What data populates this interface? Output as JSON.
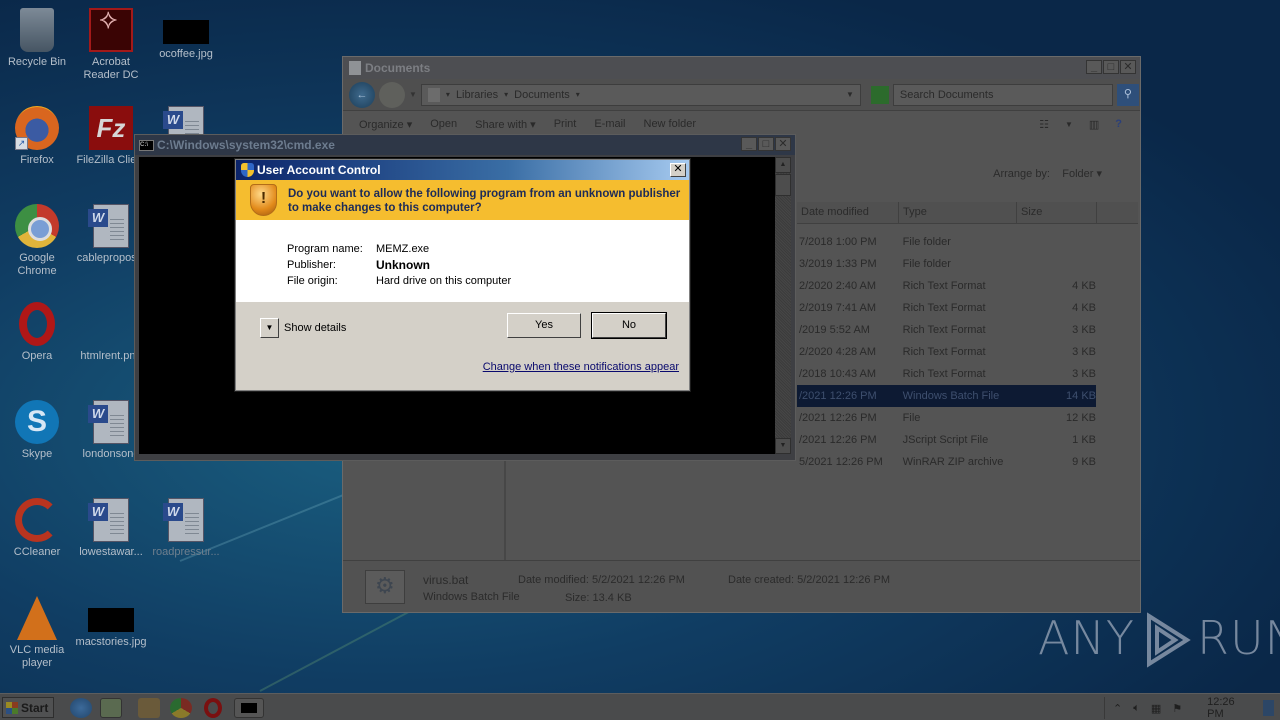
{
  "desktop": {
    "icons": [
      {
        "label": "Recycle Bin",
        "icon": "recycle-bin-icon"
      },
      {
        "label": "Acrobat Reader DC",
        "icon": "acrobat-icon"
      },
      {
        "label": "ocoffee.jpg",
        "icon": "image-file-icon"
      },
      {
        "label": "Firefox",
        "icon": "firefox-icon"
      },
      {
        "label": "FileZilla Client",
        "icon": "filezilla-icon"
      },
      {
        "label": "",
        "icon": "word-document-icon"
      },
      {
        "label": "Google Chrome",
        "icon": "chrome-icon"
      },
      {
        "label": "cableproposal",
        "icon": "word-document-icon"
      },
      {
        "label": "Opera",
        "icon": "opera-icon"
      },
      {
        "label": "htmlrent.png",
        "icon": "image-file-icon"
      },
      {
        "label": "Skype",
        "icon": "skype-icon"
      },
      {
        "label": "londonsong",
        "icon": "word-document-icon"
      },
      {
        "label": "CCleaner",
        "icon": "ccleaner-icon"
      },
      {
        "label": "lowestawar...",
        "icon": "word-document-icon"
      },
      {
        "label": "roadpressur...",
        "icon": "word-document-icon"
      },
      {
        "label": "VLC media player",
        "icon": "vlc-icon"
      },
      {
        "label": "macstories.jpg",
        "icon": "image-file-icon"
      }
    ]
  },
  "explorer": {
    "title": "Documents",
    "breadcrumb": [
      "Libraries",
      "Documents"
    ],
    "search_placeholder": "Search Documents",
    "toolbar": [
      "Organize",
      "Open",
      "Share with",
      "Print",
      "E-mail",
      "New folder"
    ],
    "arrange_by_label": "Arrange by:",
    "arrange_by_value": "Folder",
    "columns": [
      "Date modified",
      "Type",
      "Size"
    ],
    "rows": [
      {
        "date": "7/2018 1:00 PM",
        "type": "File folder",
        "size": ""
      },
      {
        "date": "3/2019 1:33 PM",
        "type": "File folder",
        "size": ""
      },
      {
        "date": "2/2020 2:40 AM",
        "type": "Rich Text Format",
        "size": "4 KB"
      },
      {
        "date": "2/2019 7:41 AM",
        "type": "Rich Text Format",
        "size": "4 KB"
      },
      {
        "date": "/2019 5:52 AM",
        "type": "Rich Text Format",
        "size": "3 KB"
      },
      {
        "date": "2/2020 4:28 AM",
        "type": "Rich Text Format",
        "size": "3 KB"
      },
      {
        "date": "/2018 10:43 AM",
        "type": "Rich Text Format",
        "size": "3 KB"
      },
      {
        "date": "/2021 12:26 PM",
        "type": "Windows Batch File",
        "size": "14 KB",
        "selected": true
      },
      {
        "date": "/2021 12:26 PM",
        "type": "File",
        "size": "12 KB"
      },
      {
        "date": "/2021 12:26 PM",
        "type": "JScript Script File",
        "size": "1 KB"
      },
      {
        "date": "5/2021 12:26 PM",
        "type": "WinRAR ZIP archive",
        "size": "9 KB"
      }
    ],
    "status": {
      "filename": "virus.bat",
      "filetype": "Windows Batch File",
      "date_modified": "Date modified: 5/2/2021 12:26 PM",
      "date_created": "Date created: 5/2/2021 12:26 PM",
      "size": "Size: 13.4 KB"
    }
  },
  "cmd": {
    "title": "C:\\Windows\\system32\\cmd.exe"
  },
  "uac": {
    "title": "User Account Control",
    "question": "Do you want to allow the following program from an unknown publisher to make changes to this computer?",
    "fields": [
      {
        "key": "Program name:",
        "value": "MEMZ.exe"
      },
      {
        "key": "Publisher:",
        "value": "Unknown"
      },
      {
        "key": "File origin:",
        "value": "Hard drive on this computer"
      }
    ],
    "show_details": "Show details",
    "yes": "Yes",
    "no": "No",
    "link": "Change when these notifications appear"
  },
  "watermark": {
    "left": "ANY",
    "right": "RUN"
  },
  "taskbar": {
    "start": "Start",
    "clock": "12:26 PM"
  }
}
